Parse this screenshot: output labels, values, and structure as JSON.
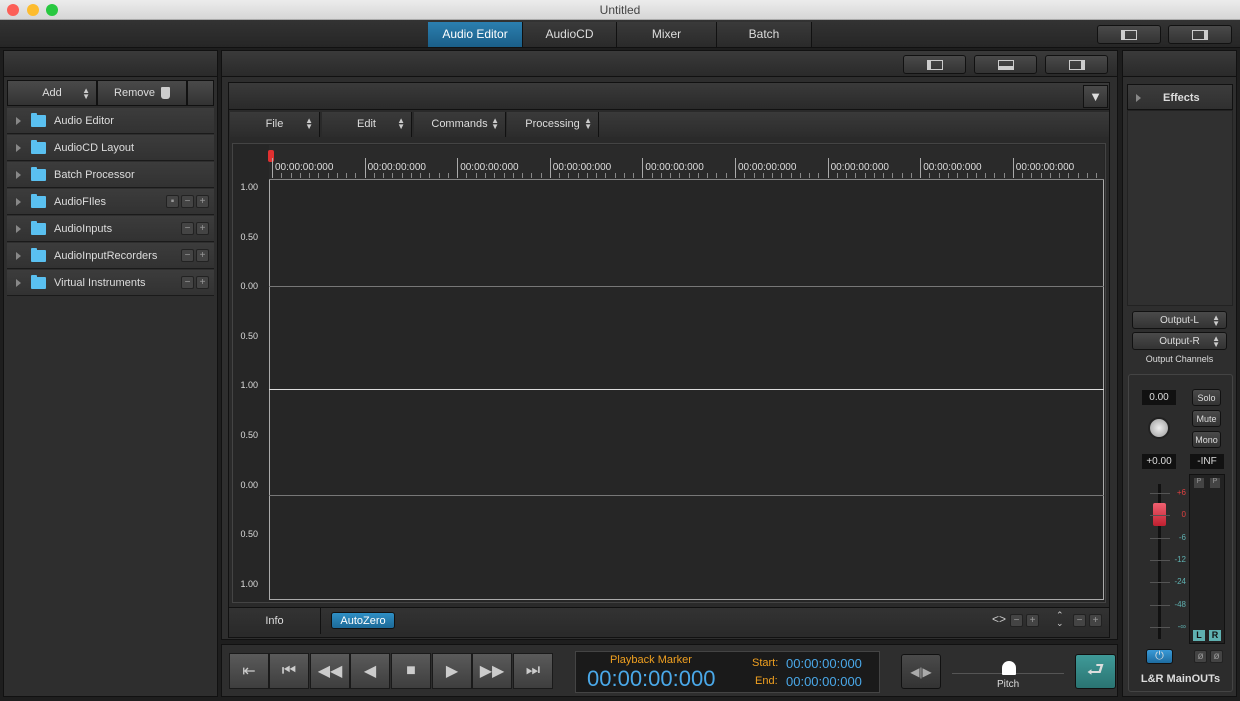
{
  "window": {
    "title": "Untitled"
  },
  "tabs": [
    {
      "label": "Audio Editor",
      "active": true
    },
    {
      "label": "AudioCD"
    },
    {
      "label": "Mixer"
    },
    {
      "label": "Batch"
    }
  ],
  "left": {
    "add": "Add",
    "remove": "Remove",
    "items": [
      {
        "label": "Audio Editor"
      },
      {
        "label": "AudioCD Layout"
      },
      {
        "label": "Batch Processor"
      },
      {
        "label": "AudioFIles",
        "controls": [
          "save",
          "-",
          "+"
        ]
      },
      {
        "label": "AudioInputs",
        "controls": [
          "-",
          "+"
        ]
      },
      {
        "label": "AudioInputRecorders",
        "controls": [
          "-",
          "+"
        ]
      },
      {
        "label": "Virtual Instruments",
        "controls": [
          "-",
          "+"
        ]
      }
    ]
  },
  "editor": {
    "menus": [
      "File",
      "Edit",
      "Commands",
      "Processing"
    ],
    "ruler": [
      "00:00:00:000",
      "00:00:00:000",
      "00:00:00:000",
      "00:00:00:000",
      "00:00:00:000",
      "00:00:00:000",
      "00:00:00:000",
      "00:00:00:000",
      "00:00:00:000"
    ],
    "yaxis": [
      "1.00",
      "0.50",
      "0.00",
      "0.50",
      "1.00",
      "0.50",
      "0.00",
      "0.50",
      "1.00"
    ],
    "info": "Info",
    "autozero": "AutoZero"
  },
  "transport": {
    "marker_label": "Playback Marker",
    "marker": "00:00:00:000",
    "start_label": "Start:",
    "start": "00:00:00:000",
    "end_label": "End:",
    "end": "00:00:00:000",
    "pitch": "Pitch"
  },
  "right": {
    "effects": "Effects",
    "output_l": "Output-L",
    "output_r": "Output-R",
    "output_channels": "Output Channels",
    "pan": "0.00",
    "gain": "+0.00",
    "peak": "-INF",
    "solo": "Solo",
    "mute": "Mute",
    "mono": "Mono",
    "scale": [
      "+6",
      "0",
      "-6",
      "-12",
      "-24",
      "-48",
      "-∞"
    ],
    "meter_l": "L",
    "meter_r": "R",
    "meter_p": "P",
    "strip": "L&R MainOUTs"
  },
  "colors": {
    "accent": "#1f6f9a",
    "orange": "#f0a020",
    "time": "#4aa8e8"
  }
}
